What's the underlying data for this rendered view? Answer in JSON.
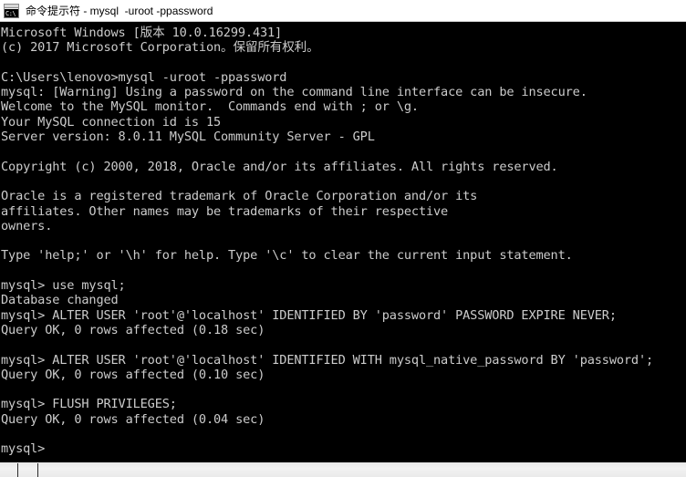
{
  "window": {
    "title": "命令提示符 - mysql  -uroot -ppassword",
    "icon": "cmd-console-icon",
    "icon_text": "C:\\",
    "titlebar_bg": "#ffffff",
    "terminal_bg": "#000000",
    "terminal_fg": "#cccccc"
  },
  "terminal": {
    "lines": [
      "Microsoft Windows [版本 10.0.16299.431]",
      "(c) 2017 Microsoft Corporation。保留所有权利。",
      "",
      "C:\\Users\\lenovo>mysql -uroot -ppassword",
      "mysql: [Warning] Using a password on the command line interface can be insecure.",
      "Welcome to the MySQL monitor.  Commands end with ; or \\g.",
      "Your MySQL connection id is 15",
      "Server version: 8.0.11 MySQL Community Server - GPL",
      "",
      "Copyright (c) 2000, 2018, Oracle and/or its affiliates. All rights reserved.",
      "",
      "Oracle is a registered trademark of Oracle Corporation and/or its",
      "affiliates. Other names may be trademarks of their respective",
      "owners.",
      "",
      "Type 'help;' or '\\h' for help. Type '\\c' to clear the current input statement.",
      "",
      "mysql> use mysql;",
      "Database changed",
      "mysql> ALTER USER 'root'@'localhost' IDENTIFIED BY 'password' PASSWORD EXPIRE NEVER;",
      "Query OK, 0 rows affected (0.18 sec)",
      "",
      "mysql> ALTER USER 'root'@'localhost' IDENTIFIED WITH mysql_native_password BY 'password';",
      "Query OK, 0 rows affected (0.10 sec)",
      "",
      "mysql> FLUSH PRIVILEGES;",
      "Query OK, 0 rows affected (0.04 sec)",
      "",
      "mysql>"
    ]
  }
}
